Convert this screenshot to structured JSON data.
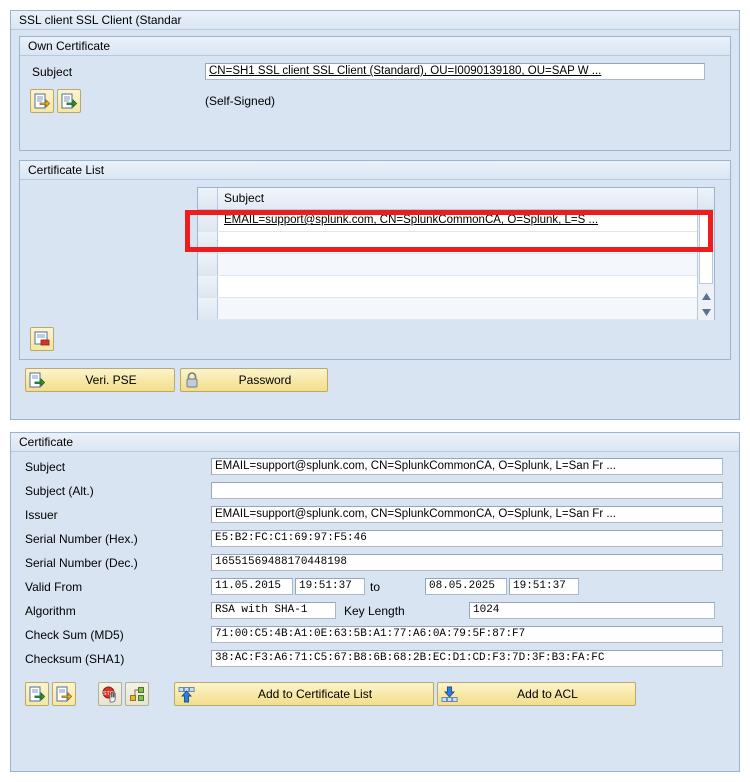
{
  "window": {
    "title": "SSL client SSL Client (Standar"
  },
  "own_certificate": {
    "title": "Own Certificate",
    "subject_label": "Subject",
    "subject_value": "CN=SH1 SSL client SSL Client (Standard), OU=I0090139180, OU=SAP W ...",
    "self_signed_text": "(Self-Signed)",
    "import_icon": "import-certificate-icon",
    "export_icon": "export-certificate-icon"
  },
  "certificate_list": {
    "title": "Certificate List",
    "column_header": "Subject",
    "rows": [
      {
        "subject": "EMAIL=support@splunk.com, CN=SplunkCommonCA, O=Splunk, L=S ..."
      },
      {
        "subject": ""
      },
      {
        "subject": ""
      },
      {
        "subject": ""
      },
      {
        "subject": ""
      },
      {
        "subject": ""
      }
    ],
    "delete_icon": "delete-entry-icon",
    "scroll_up_icon": "scroll-up-icon",
    "scroll_down_icon": "scroll-down-icon"
  },
  "pse_toolbar": {
    "veri_pse_label": "Veri. PSE",
    "veri_pse_icon": "verify-pse-icon",
    "password_label": "Password",
    "password_icon": "lock-icon"
  },
  "certificate": {
    "title": "Certificate",
    "fields": [
      {
        "label": "Subject",
        "value": "EMAIL=support@splunk.com, CN=SplunkCommonCA, O=Splunk, L=San Fr ..."
      },
      {
        "label": "Subject (Alt.)",
        "value": ""
      },
      {
        "label": "Issuer",
        "value": "EMAIL=support@splunk.com, CN=SplunkCommonCA, O=Splunk, L=San Fr ..."
      },
      {
        "label": "Serial Number (Hex.)",
        "value": "E5:B2:FC:C1:69:97:F5:46"
      },
      {
        "label": "Serial Number (Dec.)",
        "value": "16551569488170448198"
      }
    ],
    "valid_from": {
      "label": "Valid From",
      "from_date": "11.05.2015",
      "from_time": "19:51:37",
      "to_label": "to",
      "to_date": "08.05.2025",
      "to_time": "19:51:37"
    },
    "algorithm": {
      "label": "Algorithm",
      "value": "RSA with SHA-1",
      "key_length_label": "Key Length",
      "key_length_value": "1024"
    },
    "checksums": [
      {
        "label": "Check Sum (MD5)",
        "value": "71:00:C5:4B:A1:0E:63:5B:A1:77:A6:0A:79:5F:87:F7"
      },
      {
        "label": "Checksum (SHA1)",
        "value": "38:AC:F3:A6:71:C5:67:B8:6B:68:2B:EC:D1:CD:F3:7D:3F:B3:FA:FC"
      }
    ]
  },
  "bottom_toolbar": {
    "icons": [
      {
        "name": "import-certificate-icon"
      },
      {
        "name": "export-certificate-icon"
      },
      {
        "name": "revoke-certificate-icon"
      },
      {
        "name": "certificate-chain-icon"
      }
    ],
    "add_to_certificate_list_label": "Add to Certificate List",
    "add_to_certificate_list_icon": "add-up-arrow-icon",
    "add_to_acl_label": "Add to ACL",
    "add_to_acl_icon": "add-down-arrow-icon"
  },
  "annotation": {
    "highlight_color": "#ee1c1c",
    "highlight_target": "certificate-list-first-row"
  },
  "colors": {
    "panel_background": "#d8e4f2",
    "panel_border": "#9bb4d0",
    "button_yellow": "#f5e49c",
    "field_white": "#ffffff"
  }
}
